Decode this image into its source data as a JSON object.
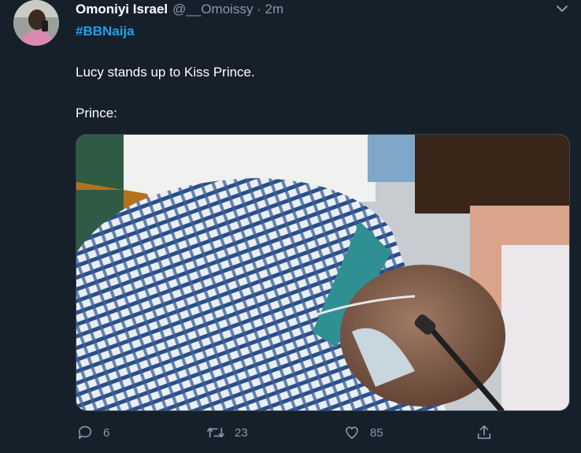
{
  "tweet": {
    "author_name": "Omoniyi Israel",
    "handle_time": "@__Omoissy · 2m",
    "hashtag": "#BBNaija",
    "text_line_1": "Lucy stands up to Kiss Prince.",
    "text_line_2": "Prince:"
  },
  "actions": {
    "reply_count": "6",
    "retweet_count": "23",
    "like_count": "85"
  },
  "icons": {
    "reply": "reply-icon",
    "retweet": "retweet-icon",
    "like": "like-icon",
    "share": "share-icon",
    "menu": "chevron-down-icon"
  },
  "colors": {
    "background": "#15202b",
    "hashtag": "#1da1f2",
    "muted": "#8899a6"
  }
}
